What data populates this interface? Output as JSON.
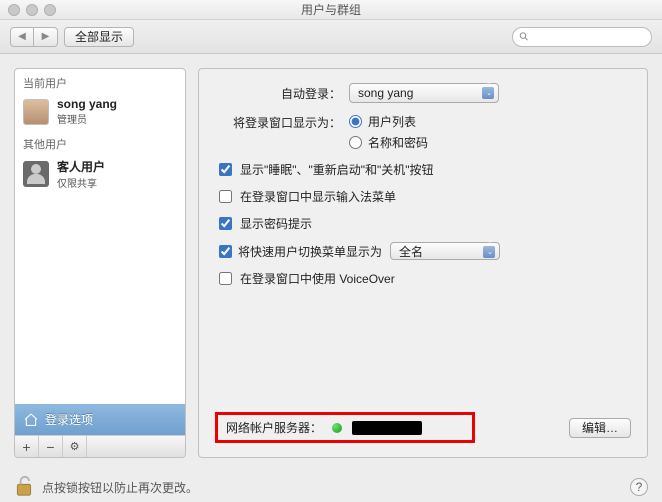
{
  "window": {
    "title": "用户与群组"
  },
  "toolbar": {
    "show_all": "全部显示",
    "search_placeholder": ""
  },
  "sidebar": {
    "current_header": "当前用户",
    "other_header": "其他用户",
    "current_user": {
      "name": "song yang",
      "role": "管理员"
    },
    "guest": {
      "name": "客人用户",
      "role": "仅限共享"
    },
    "login_options": "登录选项"
  },
  "main": {
    "auto_login": {
      "label": "自动登录：",
      "value": "song yang"
    },
    "display_as": {
      "label": "将登录窗口显示为：",
      "opt_list": "用户列表",
      "opt_name_pw": "名称和密码",
      "selected": "list"
    },
    "checks": {
      "sleep_restart_shutdown": {
        "label": "显示\"睡眠\"、\"重新启动\"和\"关机\"按钮",
        "checked": true
      },
      "input_menu": {
        "label": "在登录窗口中显示输入法菜单",
        "checked": false
      },
      "password_hint": {
        "label": "显示密码提示",
        "checked": true
      },
      "fast_switch": {
        "label": "将快速用户切换菜单显示为",
        "checked": true,
        "dropdown": "全名"
      },
      "voiceover": {
        "label": "在登录窗口中使用 VoiceOver",
        "checked": false
      }
    },
    "network": {
      "label": "网络帐户服务器：",
      "edit": "编辑…"
    }
  },
  "footer": {
    "lock_text": "点按锁按钮以防止再次更改。"
  }
}
